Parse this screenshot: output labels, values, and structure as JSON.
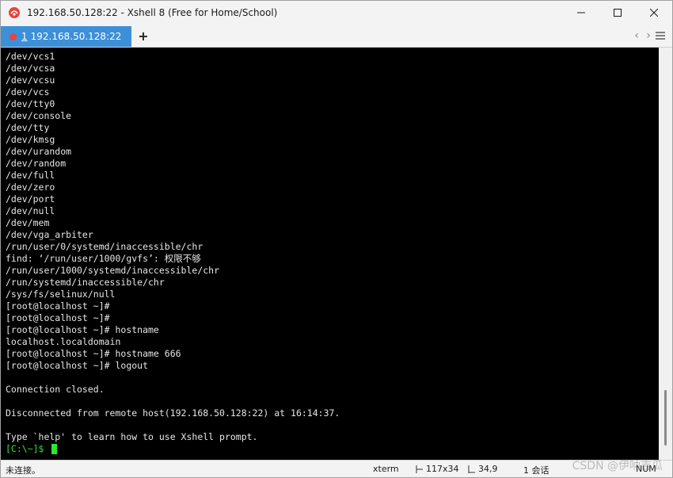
{
  "window": {
    "title": "192.168.50.128:22 - Xshell 8 (Free for Home/School)"
  },
  "tabs": [
    {
      "number": "1",
      "label": "192.168.50.128:22",
      "status_color": "#e64545",
      "active": true
    }
  ],
  "tabbar": {
    "add_icon": "+",
    "prev_icon": "‹",
    "next_icon": "›"
  },
  "terminal": {
    "lines": [
      "/dev/vcs1",
      "/dev/vcsa",
      "/dev/vcsu",
      "/dev/vcs",
      "/dev/tty0",
      "/dev/console",
      "/dev/tty",
      "/dev/kmsg",
      "/dev/urandom",
      "/dev/random",
      "/dev/full",
      "/dev/zero",
      "/dev/port",
      "/dev/null",
      "/dev/mem",
      "/dev/vga_arbiter",
      "/run/user/0/systemd/inaccessible/chr",
      "find: ‘/run/user/1000/gvfs’: 权限不够",
      "/run/user/1000/systemd/inaccessible/chr",
      "/run/systemd/inaccessible/chr",
      "/sys/fs/selinux/null",
      "[root@localhost ~]#",
      "[root@localhost ~]#",
      "[root@localhost ~]# hostname",
      "localhost.localdomain",
      "[root@localhost ~]# hostname 666",
      "[root@localhost ~]# logout",
      "",
      "Connection closed.",
      "",
      "Disconnected from remote host(192.168.50.128:22) at 16:14:37.",
      "",
      "Type `help' to learn how to use Xshell prompt."
    ],
    "prompt": "[C:\\~]$ ",
    "prompt_color": "#2fe62f",
    "background": "#000000",
    "foreground": "#e6e6e6"
  },
  "statusbar": {
    "connection_status": "未连接。",
    "terminal_type": "xterm",
    "size": "117x34",
    "cursor_pos": "34,9",
    "sessions": "1 会话",
    "num_lock": "NUM"
  },
  "watermark": "CSDN @伊呐吉瓜",
  "colors": {
    "accent": "#3d8fd8",
    "chrome": "#f3f3f3"
  }
}
